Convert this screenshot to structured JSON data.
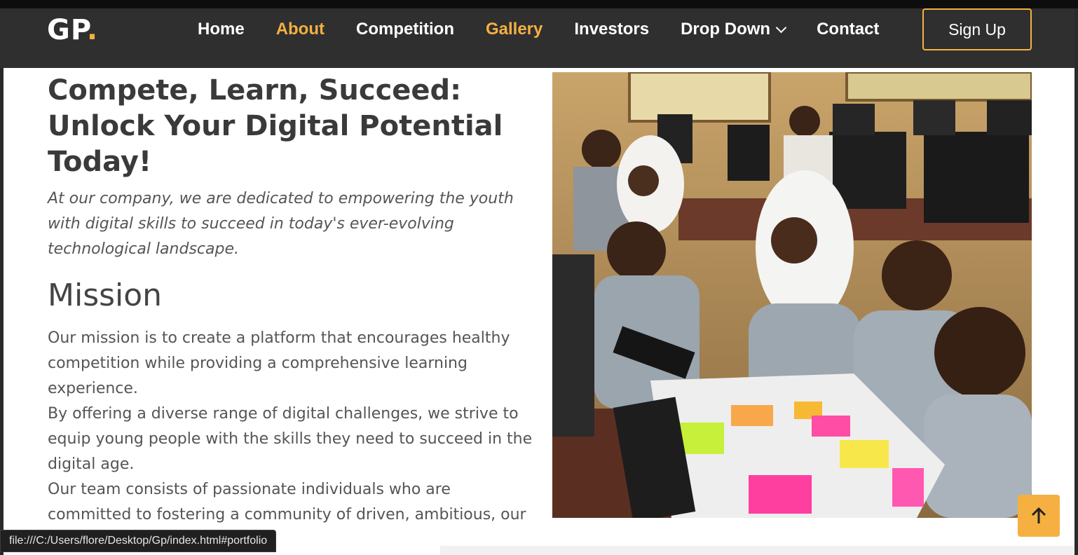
{
  "brand": {
    "logo_text": "GP",
    "logo_dot": "."
  },
  "nav": {
    "items": [
      {
        "label": "Home",
        "active": false
      },
      {
        "label": "About",
        "active": true
      },
      {
        "label": "Competition",
        "active": false
      },
      {
        "label": "Gallery",
        "active": true
      },
      {
        "label": "Investors",
        "active": false
      },
      {
        "label": "Drop Down",
        "active": false
      },
      {
        "label": "Contact",
        "active": false
      }
    ],
    "signup_label": "Sign Up"
  },
  "hero": {
    "title_lines": [
      "Compete, Learn, Succeed:",
      "Unlock Your Digital Potential",
      "Today!"
    ],
    "subtitle": "At our company, we are dedicated to empowering the youth with digital skills to succeed in today's ever-evolving technological landscape."
  },
  "mission": {
    "heading": "Mission",
    "paragraphs": [
      "Our mission is to create a platform that encourages healthy competition while providing a comprehensive learning experience.",
      "By offering a diverse range of digital challenges, we strive to equip young people with the skills they need to succeed in the digital age.",
      "Our team consists of passionate individuals who are committed to fostering a community of driven, ambitious, our mission to unlock the"
    ]
  },
  "status_bar": {
    "url": "file:///C:/Users/flore/Desktop/Gp/index.html#portfolio"
  },
  "colors": {
    "accent": "#f5b041",
    "nav_bg": "#2f2f2f",
    "heading": "#3a3a3a",
    "body_text": "#555555"
  },
  "icons": {
    "scroll_top": "arrow-up-icon",
    "dropdown": "chevron-down-icon"
  }
}
